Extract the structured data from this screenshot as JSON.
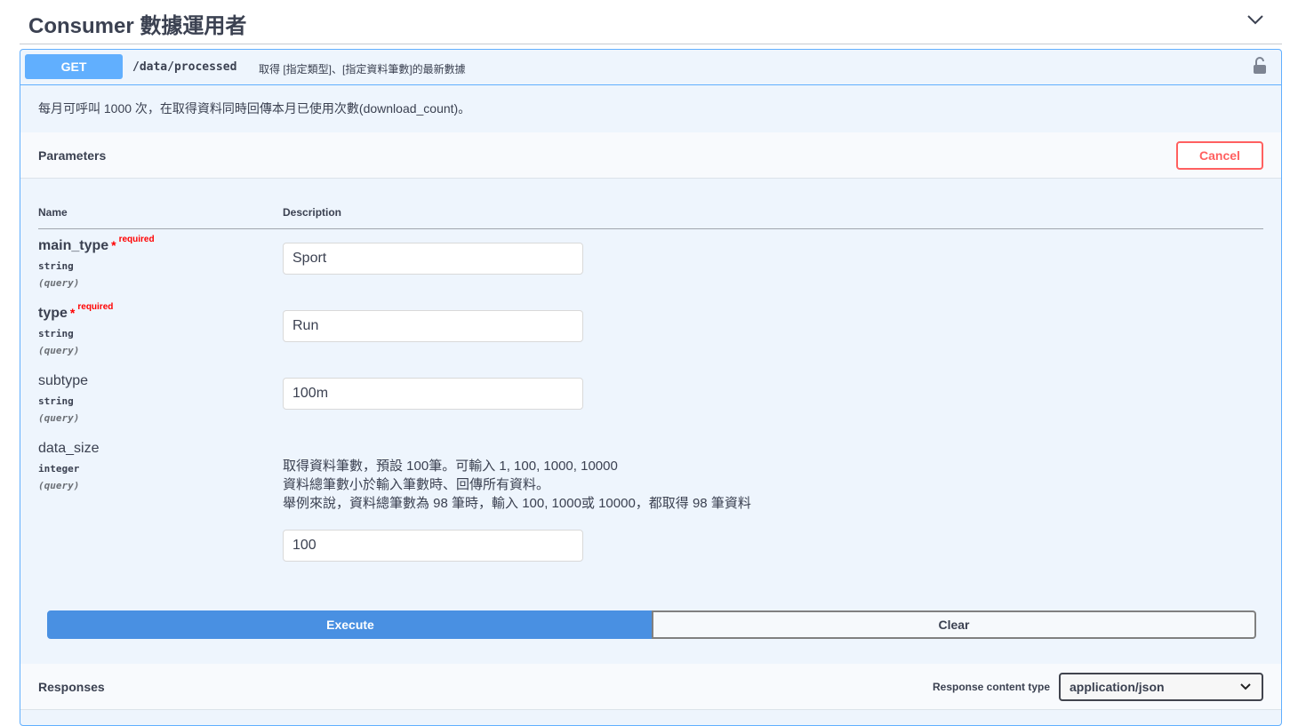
{
  "section": {
    "title": "Consumer 數據運用者",
    "chevron_icon": "chevron-down-icon"
  },
  "operation": {
    "method": "GET",
    "path": "/data/processed",
    "summary": "取得 [指定類型]、[指定資料筆數]的最新數據",
    "lock_icon": "lock-icon",
    "description": "每月可呼叫 1000 次，在取得資料同時回傳本月已使用次數(download_count)。"
  },
  "parameters": {
    "title": "Parameters",
    "cancel_label": "Cancel",
    "col_name": "Name",
    "col_description": "Description",
    "required_star": "*",
    "required_label": "required",
    "items": [
      {
        "name": "main_type",
        "required": true,
        "type": "string",
        "in": "(query)",
        "value": "Sport"
      },
      {
        "name": "type",
        "required": true,
        "type": "string",
        "in": "(query)",
        "value": "Run"
      },
      {
        "name": "subtype",
        "required": false,
        "type": "string",
        "in": "(query)",
        "value": "100m"
      },
      {
        "name": "data_size",
        "required": false,
        "type": "integer",
        "in": "(query)",
        "value": "100",
        "description_lines": [
          "取得資料筆數，預設 100筆。可輸入 1, 100, 1000, 10000",
          "資料總筆數小於輸入筆數時、回傳所有資料。",
          "舉例來說，資料總筆數為 98 筆時，輸入 100, 1000或 10000，都取得 98 筆資料"
        ]
      }
    ]
  },
  "actions": {
    "execute_label": "Execute",
    "clear_label": "Clear"
  },
  "responses": {
    "title": "Responses",
    "content_type_label": "Response content type",
    "content_type_value": "application/json"
  },
  "colors": {
    "get_blue": "#61affe",
    "execute_blue": "#4990e2",
    "cancel_red": "#ff6060",
    "required_red": "#ff0000"
  }
}
